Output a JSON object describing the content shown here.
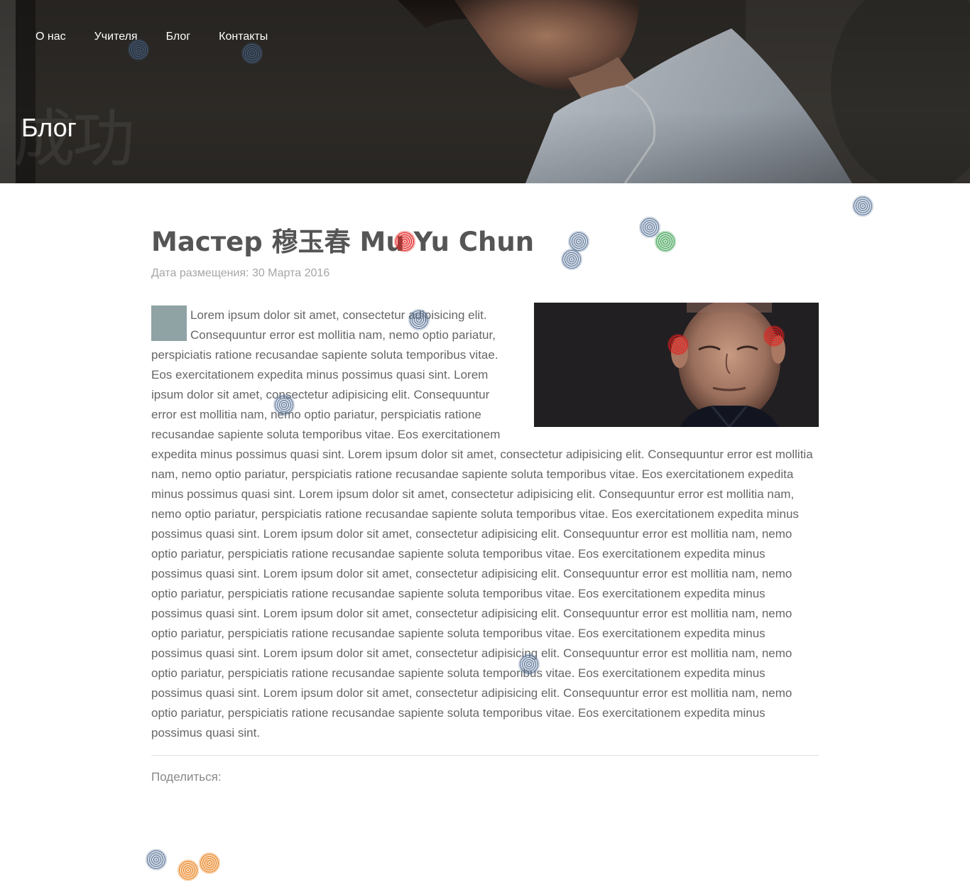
{
  "header": {
    "nav": [
      {
        "label": "О нас"
      },
      {
        "label": "Учителя"
      },
      {
        "label": "Блог"
      },
      {
        "label": "Контакты"
      }
    ],
    "page_title": "Блог",
    "watermark": "成功"
  },
  "post": {
    "title": "Мастер 穆玉春 Mu Yu Chun",
    "date": "Дата размещения: 30 Марта 2016",
    "body": "Lorem ipsum dolor sit amet, consectetur adipisicing elit. Consequuntur error est mollitia nam, nemo optio pariatur, perspiciatis ratione recusandae sapiente soluta temporibus vitae. Eos exercitationem expedita minus possimus quasi sint. Lorem ipsum dolor sit amet, consectetur adipisicing elit. Consequuntur error est mollitia nam, nemo optio pariatur, perspiciatis ratione recusandae sapiente soluta temporibus vitae. Eos exercitationem expedita minus possimus quasi sint. Lorem ipsum dolor sit amet, consectetur adipisicing elit. Consequuntur error est mollitia nam, nemo optio pariatur, perspiciatis ratione recusandae sapiente soluta temporibus vitae. Eos exercitationem expedita minus possimus quasi sint. Lorem ipsum dolor sit amet, consectetur adipisicing elit. Consequuntur error est mollitia nam, nemo optio pariatur, perspiciatis ratione recusandae sapiente soluta temporibus vitae. Eos exercitationem expedita minus possimus quasi sint. Lorem ipsum dolor sit amet, consectetur adipisicing elit. Consequuntur error est mollitia nam, nemo optio pariatur, perspiciatis ratione recusandae sapiente soluta temporibus vitae. Eos exercitationem expedita minus possimus quasi sint. Lorem ipsum dolor sit amet, consectetur adipisicing elit. Consequuntur error est mollitia nam, nemo optio pariatur, perspiciatis ratione recusandae sapiente soluta temporibus vitae. Eos exercitationem expedita minus possimus quasi sint. Lorem ipsum dolor sit amet, consectetur adipisicing elit. Consequuntur error est mollitia nam, nemo optio pariatur, perspiciatis ratione recusandae sapiente soluta temporibus vitae. Eos exercitationem expedita minus possimus quasi sint. Lorem ipsum dolor sit amet, consectetur adipisicing elit. Consequuntur error est mollitia nam, nemo optio pariatur, perspiciatis ratione recusandae sapiente soluta temporibus vitae. Eos exercitationem expedita minus possimus quasi sint. Lorem ipsum dolor sit amet, consectetur adipisicing elit. Consequuntur error est mollitia nam, nemo optio pariatur, perspiciatis ratione recusandae sapiente soluta temporibus vitae. Eos exercitationem expedita minus possimus quasi sint.",
    "share_label": "Поделиться:"
  },
  "colors": {
    "dropcap": "#8fa3a5",
    "text": "#666666",
    "date": "#a6a6a6",
    "title": "#555555"
  },
  "icons": [
    "share-vk-icon",
    "share-facebook-icon",
    "share-twitter-icon"
  ]
}
